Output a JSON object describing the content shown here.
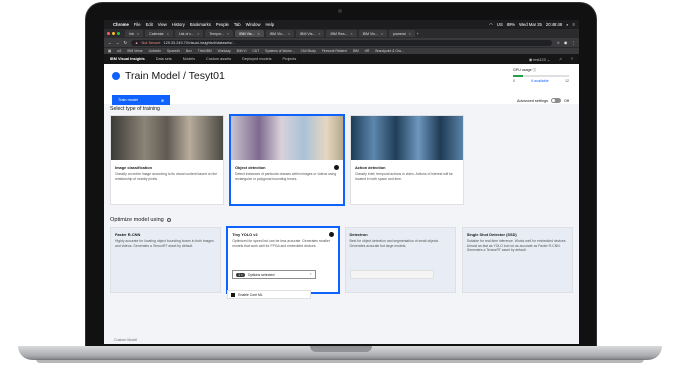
{
  "menubar": {
    "app": "Chrome",
    "items": [
      "File",
      "Edit",
      "View",
      "History",
      "Bookmarks",
      "People",
      "Tab",
      "Window",
      "Help"
    ],
    "status": [
      "US",
      "89%",
      "Wed Mar 25",
      "20:48:48"
    ]
  },
  "tabs": [
    {
      "label": "Inb",
      "active": false
    },
    {
      "label": "Calendar",
      "active": false
    },
    {
      "label": "List of c...",
      "active": false
    },
    {
      "label": "Tempor...",
      "active": false
    },
    {
      "label": "IBM Vis...",
      "active": true
    },
    {
      "label": "IBM Vis...",
      "active": false
    },
    {
      "label": "IBM Vis...",
      "active": false
    },
    {
      "label": "IBM Rea...",
      "active": false
    },
    {
      "label": "IBM Vis...",
      "active": false
    },
    {
      "label": "powerai",
      "active": false
    }
  ],
  "address": {
    "security": "Not Secure",
    "url": "129.33.249.70/visual-insights/#/datasets/..."
  },
  "bookmarks": [
    "w3",
    "IBM Verse",
    "LinkedIn",
    "Spacedir",
    "Box",
    "ThinkIBM",
    "Workday",
    "IBM VI",
    "C&T",
    "Systems of Worke...",
    "CMi Study",
    "Firework Related",
    "IBM",
    "HR",
    "Brandpoint & Ora..."
  ],
  "app": {
    "brand": "IBM Visual Insights",
    "nav": [
      "Data sets",
      "Models",
      "Custom assets",
      "Deployed models",
      "Projects"
    ],
    "user": "test123"
  },
  "page": {
    "title": "Train Model / Tesyt01",
    "train_button": "Train model",
    "advanced_settings": "Advanced settings",
    "toggle_state": "Off",
    "gpu": {
      "label": "GPU usage",
      "used": "0",
      "available_link": "6 available",
      "total": "12",
      "usage_fraction": 0.18
    },
    "select_type_label": "Select type of training",
    "training_types": [
      {
        "title": "Image classification",
        "desc": "Classify an entire image according to its visual content based on the relationship of nearby pixels.",
        "selected": false
      },
      {
        "title": "Object detection",
        "desc": "Detect instances of particular classes within images or videos using rectangular or polygonal bounding boxes.",
        "selected": true
      },
      {
        "title": "Action detection",
        "desc": "Classify brief, temporal actions in video. Actions of interest will be located in both space and time.",
        "selected": false
      }
    ],
    "optimize_label": "Optimize model using",
    "models": [
      {
        "title": "Faster R-CNN",
        "desc": "Highly accurate for locating object bounding boxes in both images and videos. Generates a TensorRT asset by default.",
        "selected": false
      },
      {
        "title": "Tiny YOLO v2",
        "desc": "Optimized for speed but can be less accurate. Generates smaller models that work well for FPGA and embedded devices.",
        "selected": true
      },
      {
        "title": "Detectron",
        "desc": "Best for object detection and segmentation of small objects. Generates accurate but large models.",
        "selected": false
      },
      {
        "title": "Single Shot Detector (SSD)",
        "desc": "Suitable for real-time inference. Works well for embedded devices. Almost as fast as YOLO but not as accurate as Faster R-CNN. Generates a TensorRT asset by default.",
        "selected": false
      }
    ],
    "dropdown": {
      "count": "1",
      "label": "Options selected"
    },
    "dropdown_option": "Enable Core ML",
    "footnote": "Custom Model"
  }
}
